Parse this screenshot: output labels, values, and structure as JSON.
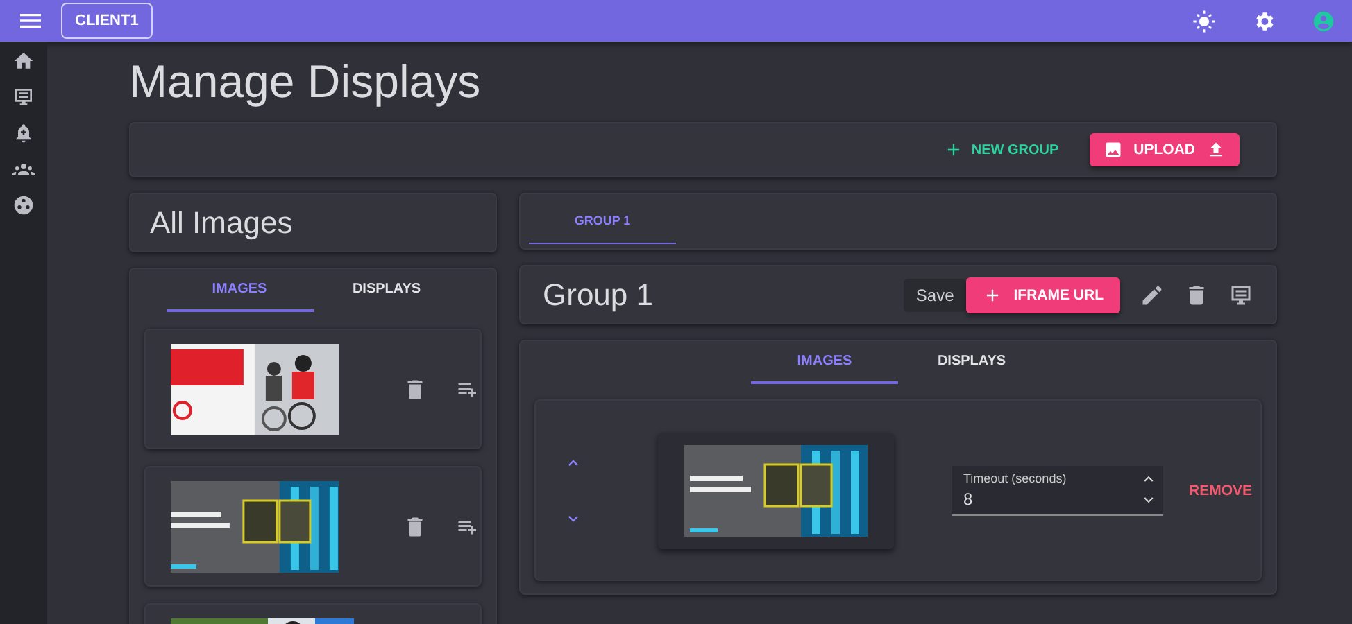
{
  "app_bar": {
    "client": "CLIENT1"
  },
  "page_title": "Manage Displays",
  "toolbar": {
    "new_group": "NEW GROUP",
    "upload": "UPLOAD"
  },
  "all_images": {
    "title": "All Images",
    "tabs": [
      {
        "label": "IMAGES",
        "selected": true
      },
      {
        "label": "DISPLAYS",
        "selected": false
      }
    ],
    "images": [
      {
        "kind": "picture",
        "actions": true
      },
      {
        "kind": "picture",
        "actions": true
      },
      {
        "kind": "picture"
      }
    ]
  },
  "group_tabs": [
    {
      "label": "GROUP 1",
      "selected": true
    }
  ],
  "group": {
    "title": "Group 1",
    "save": "Save",
    "iframe": "IFRAME URL",
    "tabs": [
      {
        "label": "IMAGES",
        "selected": true
      },
      {
        "label": "DISPLAYS",
        "selected": false
      }
    ],
    "items": [
      {
        "kind": "picture",
        "timeout_label": "Timeout (seconds)",
        "timeout": "8",
        "remove": "REMOVE"
      }
    ]
  }
}
